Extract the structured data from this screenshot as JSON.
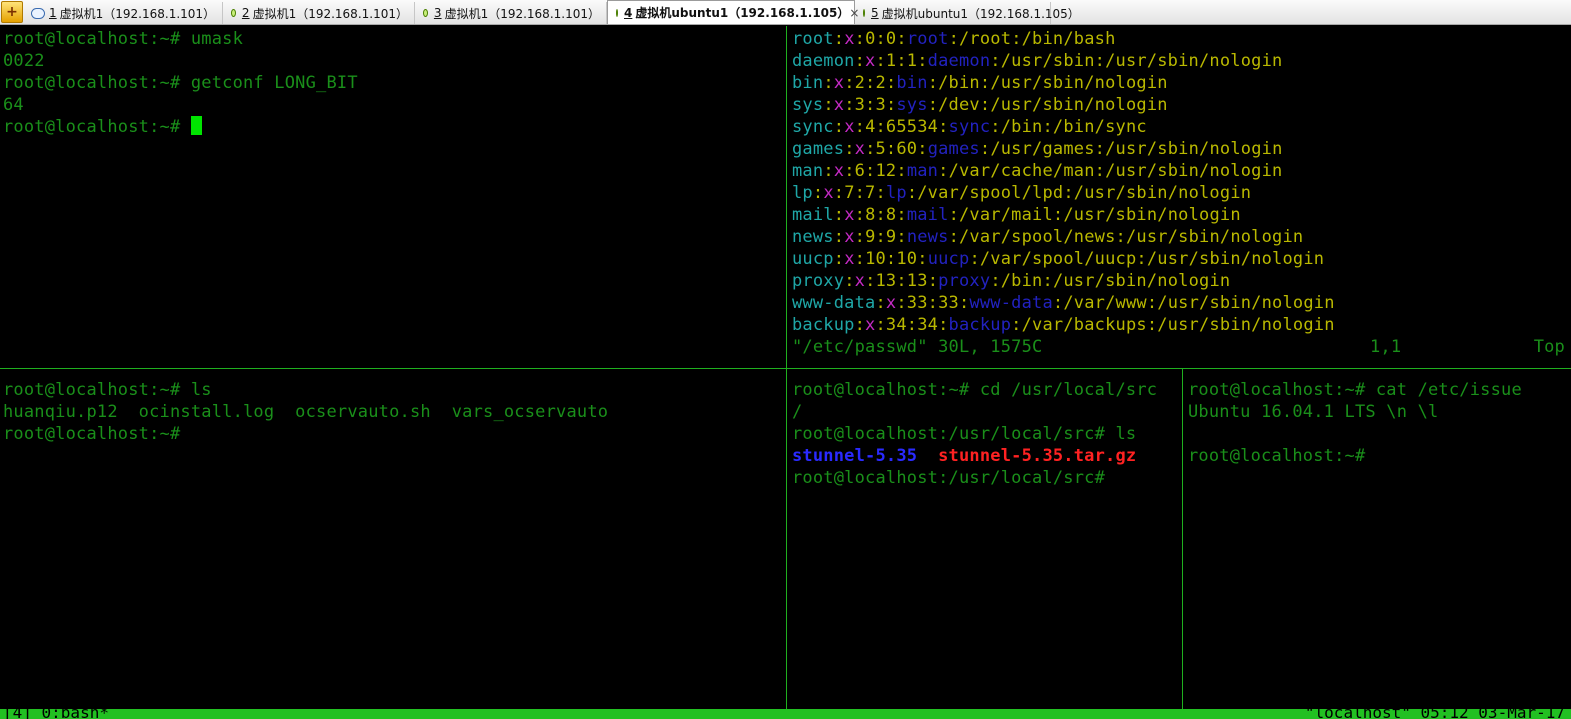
{
  "tabs": [
    {
      "num": "1",
      "label": "虚拟机1（192.168.1.101）"
    },
    {
      "num": "2",
      "label": "虚拟机1（192.168.1.101）"
    },
    {
      "num": "3",
      "label": "虚拟机1（192.168.1.101）"
    },
    {
      "num": "4",
      "label": "虚拟机ubuntu1（192.168.1.105）",
      "close": "×"
    },
    {
      "num": "5",
      "label": "虚拟机ubuntu1（192.168.1.105）"
    }
  ],
  "panes": {
    "top_left": [
      "root@localhost:~# umask",
      "0022",
      "root@localhost:~# getconf LONG_BIT",
      "64",
      "root@localhost:~# "
    ],
    "top_right": {
      "passwd": [
        {
          "user": "root",
          "pw": "x",
          "ids": "0:0",
          "gecos": "root",
          "home": "/root",
          "shell": "/bin/bash"
        },
        {
          "user": "daemon",
          "pw": "x",
          "ids": "1:1",
          "gecos": "daemon",
          "home": "/usr/sbin",
          "shell": "/usr/sbin/nologin"
        },
        {
          "user": "bin",
          "pw": "x",
          "ids": "2:2",
          "gecos": "bin",
          "home": "/bin",
          "shell": "/usr/sbin/nologin"
        },
        {
          "user": "sys",
          "pw": "x",
          "ids": "3:3",
          "gecos": "sys",
          "home": "/dev",
          "shell": "/usr/sbin/nologin"
        },
        {
          "user": "sync",
          "pw": "x",
          "ids": "4:65534",
          "gecos": "sync",
          "home": "/bin",
          "shell": "/bin/sync"
        },
        {
          "user": "games",
          "pw": "x",
          "ids": "5:60",
          "gecos": "games",
          "home": "/usr/games",
          "shell": "/usr/sbin/nologin"
        },
        {
          "user": "man",
          "pw": "x",
          "ids": "6:12",
          "gecos": "man",
          "home": "/var/cache/man",
          "shell": "/usr/sbin/nologin"
        },
        {
          "user": "lp",
          "pw": "x",
          "ids": "7:7",
          "gecos": "lp",
          "home": "/var/spool/lpd",
          "shell": "/usr/sbin/nologin"
        },
        {
          "user": "mail",
          "pw": "x",
          "ids": "8:8",
          "gecos": "mail",
          "home": "/var/mail",
          "shell": "/usr/sbin/nologin"
        },
        {
          "user": "news",
          "pw": "x",
          "ids": "9:9",
          "gecos": "news",
          "home": "/var/spool/news",
          "shell": "/usr/sbin/nologin"
        },
        {
          "user": "uucp",
          "pw": "x",
          "ids": "10:10",
          "gecos": "uucp",
          "home": "/var/spool/uucp",
          "shell": "/usr/sbin/nologin"
        },
        {
          "user": "proxy",
          "pw": "x",
          "ids": "13:13",
          "gecos": "proxy",
          "home": "/bin",
          "shell": "/usr/sbin/nologin"
        },
        {
          "user": "www-data",
          "pw": "x",
          "ids": "33:33",
          "gecos": "www-data",
          "home": "/var/www",
          "shell": "/usr/sbin/nologin"
        },
        {
          "user": "backup",
          "pw": "x",
          "ids": "34:34",
          "gecos": "backup",
          "home": "/var/backups",
          "shell": "/usr/sbin/nologin"
        }
      ],
      "vim_status": {
        "file": "\"/etc/passwd\" 30L, 1575C",
        "cursor": "1,1",
        "scroll": "Top"
      }
    },
    "bottom_left": {
      "prompt_ls": "root@localhost:~# ls",
      "files": "huanqiu.p12  ocinstall.log  ocservauto.sh  vars_ocservauto",
      "prompt": "root@localhost:~#"
    },
    "bottom_middle": {
      "line1": "root@localhost:~# cd /usr/local/src",
      "line2": "/",
      "line3": "root@localhost:/usr/local/src# ls",
      "dir": "stunnel-5.35",
      "archive": "stunnel-5.35.tar.gz",
      "line5": "root@localhost:/usr/local/src#"
    },
    "bottom_right": [
      "root@localhost:~# cat /etc/issue",
      "Ubuntu 16.04.1 LTS \\n \\l",
      "",
      "root@localhost:~#"
    ]
  },
  "statusbar": {
    "left": "[4] 0:bash*",
    "right": "\"localhost\" 05:12 03-Mar-17"
  }
}
